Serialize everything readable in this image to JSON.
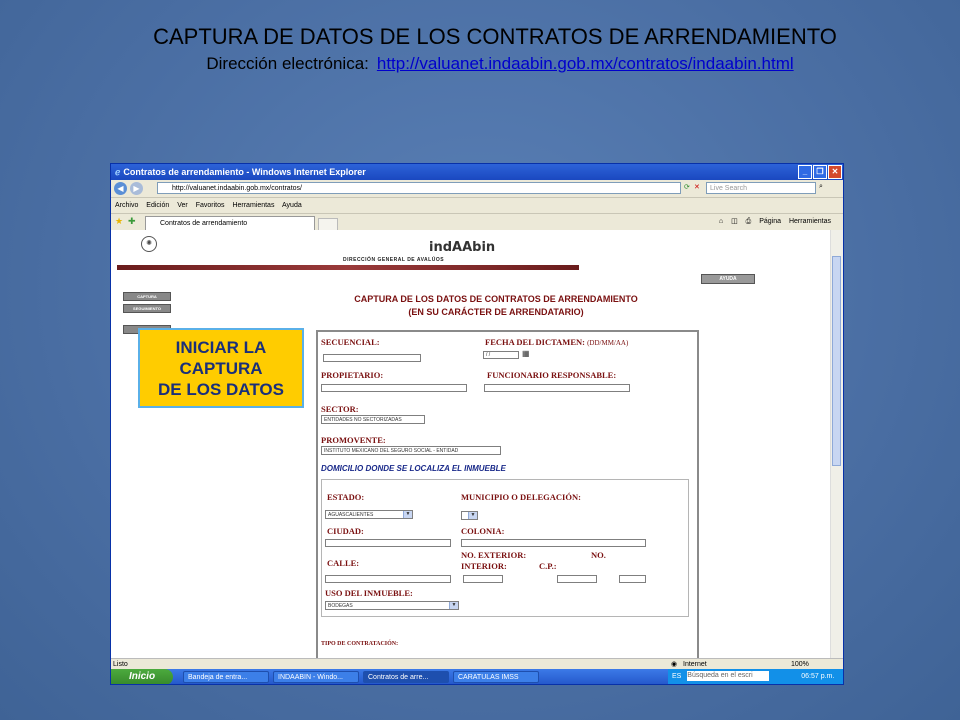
{
  "slide": {
    "title": "CAPTURA DE DATOS DE LOS CONTRATOS DE ARRENDAMIENTO",
    "subtitle_label": "Dirección electrónica:",
    "subtitle_link": "http://valuanet.indaabin.gob.mx/contratos/indaabin.html"
  },
  "browser": {
    "window_title": "Contratos de arrendamiento - Windows Internet Explorer",
    "address": "http://valuanet.indaabin.gob.mx/contratos/",
    "search_placeholder": "Live Search",
    "menu": [
      "Archivo",
      "Edición",
      "Ver",
      "Favoritos",
      "Herramientas",
      "Ayuda"
    ],
    "tab_label": "Contratos de arrendamiento",
    "toolbar_page": "Página",
    "toolbar_tools": "Herramientas",
    "status_left": "Listo",
    "status_zone": "Internet",
    "zoom": "100%"
  },
  "taskbar": {
    "start": "Inicio",
    "items": [
      "Bandeja de entra...",
      "INDAABIN - Windo...",
      "Contratos de arre...",
      "CARATULAS IMSS"
    ],
    "lang": "ES",
    "search": "Búsqueda en el escri",
    "clock": "06:57 p.m."
  },
  "page": {
    "brand": "indAAbin",
    "brand_sub": "DIRECCIÓN GENERAL DE AVALÚOS",
    "side_buttons": [
      "CAPTURA",
      "SEGUIMIENTO",
      "AYUDA"
    ],
    "help_button": "AYUDA",
    "title_line1": "CAPTURA DE LOS DATOS DE CONTRATOS DE ARRENDAMIENTO",
    "title_line2": "(EN SU CARÁCTER DE ARRENDATARIO)",
    "form": {
      "secuencial": "SECUENCIAL:",
      "fecha": "FECHA DEL DICTAMEN:",
      "fecha_fmt": "(DD/MM/AA)",
      "fecha_value": "/ /",
      "propietario": "PROPIETARIO:",
      "funcionario": "FUNCIONARIO RESPONSABLE:",
      "sector": "SECTOR:",
      "sector_value": "ENTIDADES NO SECTORIZADAS",
      "promovente": "PROMOVENTE:",
      "promovente_value": "INSTITUTO MEXICANO DEL SEGURO SOCIAL - ENTIDAD",
      "domicilio": "DOMICILIO DONDE SE LOCALIZA EL INMUEBLE",
      "estado": "ESTADO:",
      "estado_value": "AGUASCALIENTES",
      "municipio": "MUNICIPIO O DELEGACIÓN:",
      "ciudad": "CIUDAD:",
      "colonia": "COLONIA:",
      "calle": "CALLE:",
      "no_exterior": "NO. EXTERIOR:",
      "no_interior_a": "NO.",
      "no_interior_b": "INTERIOR:",
      "cp": "C.P.:",
      "uso": "USO DEL INMUEBLE:",
      "uso_value": "BODEGAS",
      "tipo": "TIPO DE CONTRATACIÓN:"
    }
  },
  "callout": [
    "INICIAR LA",
    "CAPTURA",
    "DE LOS DATOS"
  ]
}
